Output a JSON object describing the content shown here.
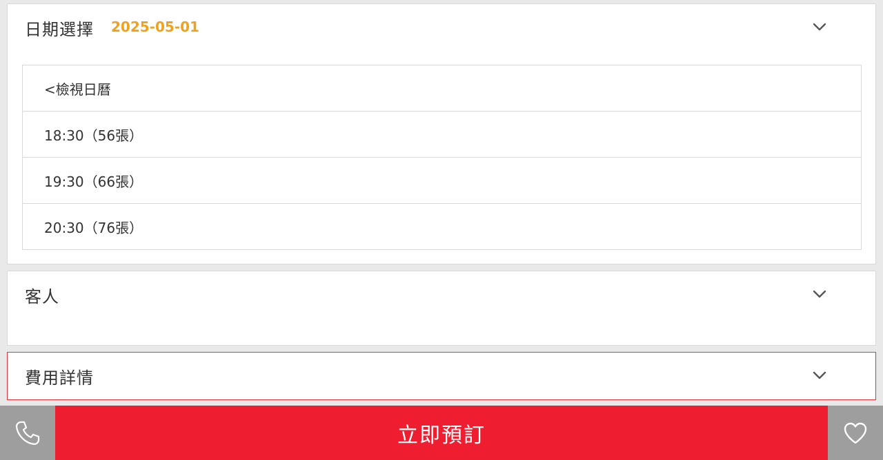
{
  "date_section": {
    "title": "日期選擇",
    "selected_date": "2025-05-01",
    "time_slots": [
      {
        "label": "<檢視日曆"
      },
      {
        "label": "18:30（56張）"
      },
      {
        "label": "19:30（66張）"
      },
      {
        "label": "20:30（76張）"
      }
    ]
  },
  "guests_section": {
    "title": "客人"
  },
  "fees_section": {
    "title": "費用詳情"
  },
  "bottom_bar": {
    "book_label": "立即預訂",
    "phone_icon": "phone-icon",
    "favorite_icon": "heart-icon"
  },
  "colors": {
    "accent_red": "#ee1e30",
    "date_orange": "#f0a11e",
    "side_button_gray": "#9e9e9e"
  }
}
